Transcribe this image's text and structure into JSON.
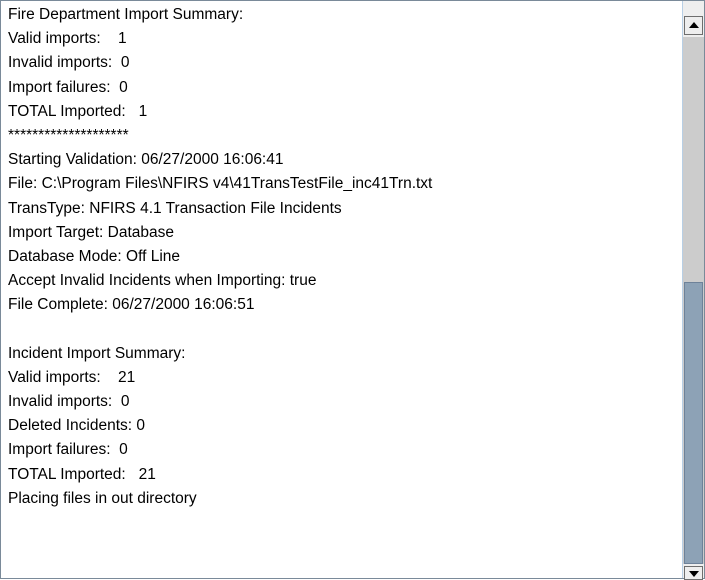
{
  "log": {
    "lines": [
      "Fire Department Import Summary:",
      "Valid imports:    1",
      "Invalid imports:  0",
      "Import failures:  0",
      "TOTAL Imported:   1",
      "********************",
      "Starting Validation: 06/27/2000 16:06:41",
      "File: C:\\Program Files\\NFIRS v4\\41TransTestFile_inc41Trn.txt",
      "TransType: NFIRS 4.1 Transaction File Incidents",
      "Import Target: Database",
      "Database Mode: Off Line",
      "Accept Invalid Incidents when Importing: true",
      "File Complete: 06/27/2000 16:06:51",
      "",
      "Incident Import Summary:",
      "Valid imports:    21",
      "Invalid imports:  0",
      "Deleted Incidents: 0",
      "Import failures:  0",
      "TOTAL Imported:   21",
      "Placing files in out directory"
    ]
  },
  "scrollbar": {
    "icons": {
      "up": "arrow-up-icon",
      "down": "arrow-down-icon"
    },
    "position_fraction": 1.0,
    "colors": {
      "thumb": "#8da2b6",
      "track": "#cccccc"
    }
  }
}
